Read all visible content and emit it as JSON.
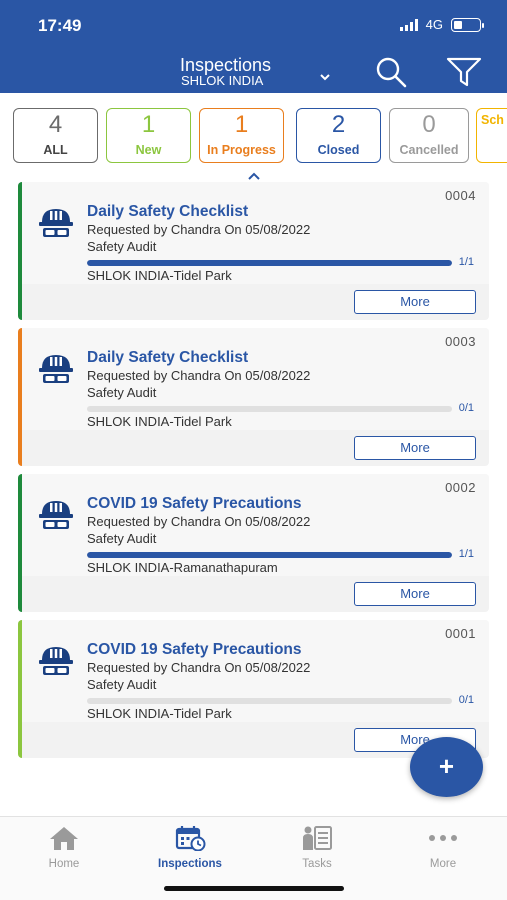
{
  "status_bar": {
    "time": "17:49",
    "network": "4G"
  },
  "header": {
    "title": "Inspections",
    "subtitle": "SHLOK INDIA",
    "icons": [
      "search-icon",
      "filter-icon",
      "chevron-down-icon"
    ]
  },
  "tabs": [
    {
      "count": "4",
      "label": "ALL",
      "color": "#6b6b6b"
    },
    {
      "count": "1",
      "label": "New",
      "color": "#8cc63f"
    },
    {
      "count": "1",
      "label": "In Progress",
      "color": "#e97e1e"
    },
    {
      "count": "2",
      "label": "Closed",
      "color": "#2a56a5"
    },
    {
      "count": "0",
      "label": "Cancelled",
      "color": "#9a9a9a"
    },
    {
      "count": "",
      "label": "Sch",
      "color": "#f2b400"
    }
  ],
  "cards": [
    {
      "number": "0004",
      "title": "Daily Safety Checklist",
      "requested": "Requested by Chandra On  05/08/2022",
      "type": "Safety Audit",
      "progress_text": "1/1",
      "progress": 1.0,
      "site": "SHLOK INDIA-Tidel Park",
      "accent": "#1e8a3c",
      "more_label": "More"
    },
    {
      "number": "0003",
      "title": "Daily Safety Checklist",
      "requested": "Requested by Chandra On  05/08/2022",
      "type": "Safety Audit",
      "progress_text": "0/1",
      "progress": 0.0,
      "site": "SHLOK INDIA-Tidel Park",
      "accent": "#e97e1e",
      "more_label": "More"
    },
    {
      "number": "0002",
      "title": "COVID 19 Safety Precautions",
      "requested": "Requested by Chandra On  05/08/2022",
      "type": "Safety Audit",
      "progress_text": "1/1",
      "progress": 1.0,
      "site": "SHLOK INDIA-Ramanathapuram",
      "accent": "#1e8a3c",
      "more_label": "More"
    },
    {
      "number": "0001",
      "title": "COVID 19 Safety Precautions",
      "requested": "Requested by Chandra On  05/08/2022",
      "type": "Safety Audit",
      "progress_text": "0/1",
      "progress": 0.0,
      "site": "SHLOK INDIA-Tidel Park",
      "accent": "#8cc63f",
      "more_label": "More"
    }
  ],
  "fab": {
    "label": "+"
  },
  "bottom_nav": [
    {
      "label": "Home",
      "icon": "home-icon"
    },
    {
      "label": "Inspections",
      "icon": "calendar-icon",
      "active": true
    },
    {
      "label": "Tasks",
      "icon": "tasks-icon"
    },
    {
      "label": "More",
      "icon": "more-icon"
    }
  ]
}
